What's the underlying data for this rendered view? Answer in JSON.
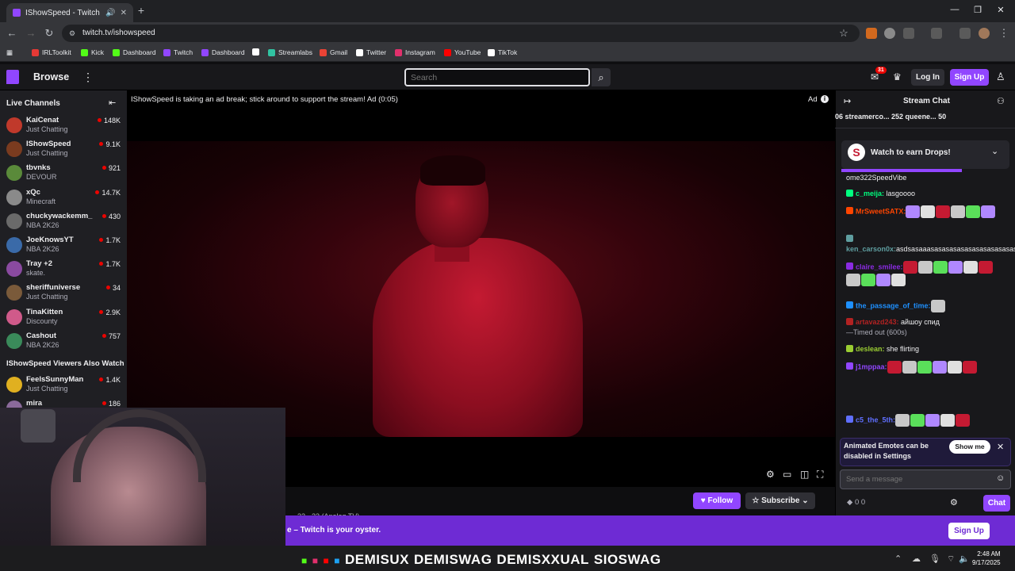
{
  "browser": {
    "tab_title": "IShowSpeed - Twitch",
    "tab_audio_icon": "speaker-icon",
    "url": "twitch.tv/ishowspeed",
    "bookmarks": [
      {
        "label": "IRLToolkit",
        "color": "#e53935"
      },
      {
        "label": "Kick",
        "color": "#53fc18"
      },
      {
        "label": "Dashboard",
        "color": "#53fc18"
      },
      {
        "label": "Twitch",
        "color": "#9146ff"
      },
      {
        "label": "Dashboard",
        "color": "#9146ff"
      },
      {
        "label": "",
        "color": "#ffffff"
      },
      {
        "label": "Streamlabs",
        "color": "#31c3a2"
      },
      {
        "label": "Gmail",
        "color": "#ea4335"
      },
      {
        "label": "Twitter",
        "color": "#ffffff"
      },
      {
        "label": "Instagram",
        "color": "#e1306c"
      },
      {
        "label": "YouTube",
        "color": "#ff0000"
      },
      {
        "label": "TikTok",
        "color": "#ffffff"
      }
    ]
  },
  "twitch": {
    "browse_label": "Browse",
    "search_placeholder": "Search",
    "notification_count": "31",
    "login_label": "Log In",
    "signup_label": "Sign Up",
    "accent": "#9146ff"
  },
  "sidebar": {
    "title": "Live Channels",
    "channels": [
      {
        "name": "KaiCenat",
        "game": "Just Chatting",
        "viewers": "148K",
        "color": "#c0392b"
      },
      {
        "name": "IShowSpeed",
        "game": "Just Chatting",
        "viewers": "9.1K",
        "color": "#7a3b1f"
      },
      {
        "name": "tbvnks",
        "game": "DEVOUR",
        "viewers": "921",
        "color": "#5a8a3a"
      },
      {
        "name": "xQc",
        "game": "Minecraft",
        "viewers": "14.7K",
        "color": "#8a8a8a"
      },
      {
        "name": "chuckywackemm_",
        "game": "NBA 2K26",
        "viewers": "430",
        "color": "#6a6a6a"
      },
      {
        "name": "JoeKnowsYT",
        "game": "NBA 2K26",
        "viewers": "1.7K",
        "color": "#3a6aa8"
      },
      {
        "name": "Tray +2",
        "game": "skate.",
        "viewers": "1.7K",
        "color": "#8a4aa0"
      },
      {
        "name": "sheriffuniverse",
        "game": "Just Chatting",
        "viewers": "34",
        "color": "#7a5a3a"
      },
      {
        "name": "TinaKitten",
        "game": "Discounty",
        "viewers": "2.9K",
        "color": "#d05a8a"
      },
      {
        "name": "Cashout",
        "game": "NBA 2K26",
        "viewers": "757",
        "color": "#3a8a5a"
      }
    ],
    "also_watch_title": "IShowSpeed Viewers Also Watch",
    "also_watch": [
      {
        "name": "FeelsSunnyMan",
        "game": "Just Chatting",
        "viewers": "1.4K",
        "color": "#e0b020"
      },
      {
        "name": "mira",
        "game": "",
        "viewers": "186",
        "color": "#8a6a9a"
      }
    ]
  },
  "player": {
    "ad_message": "IShowSpeed is taking an ad break; stick around to support the stream! Ad (0:05)",
    "ad_label": "Ad",
    "follow_label": "Follow",
    "subscribe_label": "Subscribe",
    "blurred_text": "32 · 23 (Analog TV)"
  },
  "banner": {
    "text": "e – Twitch is your oyster.",
    "signup_label": "Sign Up"
  },
  "chat": {
    "title": "Stream Chat",
    "gifts": "06  streamerco... 252  queene... 50",
    "drops_label": "Watch to earn Drops!",
    "messages": [
      {
        "user": "",
        "text": "ome322SpeedVibe",
        "color": "#efeff1"
      },
      {
        "user": "c_meija:",
        "text": " lasgoooo",
        "color": "#00ff7f"
      },
      {
        "user": "MrSweetSATX:",
        "text": "",
        "color": "#ff4500"
      },
      {
        "user": "ken_carson0x:",
        "text": "asdsasaaasasasasasasasasasasasas",
        "color": "#5f9ea0"
      },
      {
        "user": "claire_smilee:",
        "text": "",
        "color": "#8a2be2"
      },
      {
        "user": "the_passage_of_time:",
        "text": "",
        "color": "#1e90ff"
      },
      {
        "user": "artavazd243:",
        "text": " айшоу спид",
        "color": "#b22222"
      },
      {
        "user": "",
        "text": "—Timed out (600s)",
        "color": "#adadb8"
      },
      {
        "user": "deslean:",
        "text": " she flirting",
        "color": "#9acd32"
      },
      {
        "user": "j1mppaa:",
        "text": "",
        "color": "#9146ff"
      },
      {
        "user": "c5_the_5th:",
        "text": "",
        "color": "#5f6fff"
      }
    ],
    "toast_text": "Animated Emotes can be disabled in Settings",
    "toast_button": "Show me",
    "input_placeholder": "Send a message",
    "points": "0  0",
    "chat_button": "Chat"
  },
  "taskbar": {
    "ticker": [
      "DEMISUX",
      "DEMISWAG",
      "DEMISXXUAL",
      "SIOSWAG"
    ],
    "time": "2:48 AM",
    "date": "9/17/2025"
  }
}
